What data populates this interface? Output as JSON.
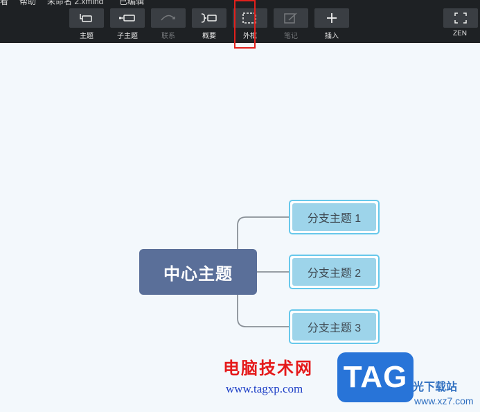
{
  "menu": {
    "items": [
      {
        "label": "看"
      },
      {
        "label": "帮助"
      },
      {
        "label": "未命名 2.xmind"
      },
      {
        "label": "已编辑"
      }
    ]
  },
  "toolbar": {
    "buttons": [
      {
        "id": "topic",
        "label": "主题",
        "icon": "topic-icon",
        "enabled": true
      },
      {
        "id": "subtopic",
        "label": "子主题",
        "icon": "subtopic-icon",
        "enabled": true
      },
      {
        "id": "relationship",
        "label": "联系",
        "icon": "relationship-icon",
        "enabled": false
      },
      {
        "id": "summary",
        "label": "概要",
        "icon": "summary-icon",
        "enabled": true
      },
      {
        "id": "boundary",
        "label": "外框",
        "icon": "boundary-icon",
        "enabled": true
      },
      {
        "id": "note",
        "label": "笔记",
        "icon": "note-icon",
        "enabled": false
      },
      {
        "id": "insert",
        "label": "插入",
        "icon": "plus-icon",
        "enabled": true
      },
      {
        "id": "zen",
        "label": "ZEN",
        "icon": "fullscreen-icon",
        "enabled": true
      }
    ]
  },
  "mindmap": {
    "central_topic": "中心主题",
    "subtopics": [
      {
        "label": "分支主题 1"
      },
      {
        "label": "分支主题 2"
      },
      {
        "label": "分支主题 3"
      }
    ]
  },
  "colors": {
    "toolbar_bg": "#1e2124",
    "canvas_bg": "#f3f8fc",
    "central_topic_bg": "#5a6f99",
    "subtopic_fill": "#9dd4ea",
    "subtopic_border": "#67c8eb",
    "highlight": "#e2201c"
  },
  "watermark": {
    "title": "电脑技术网",
    "url": "www.tagxp.com",
    "logo_text": "TAG",
    "site_cn": "光下载站",
    "site_url": "www.xz7.com"
  }
}
